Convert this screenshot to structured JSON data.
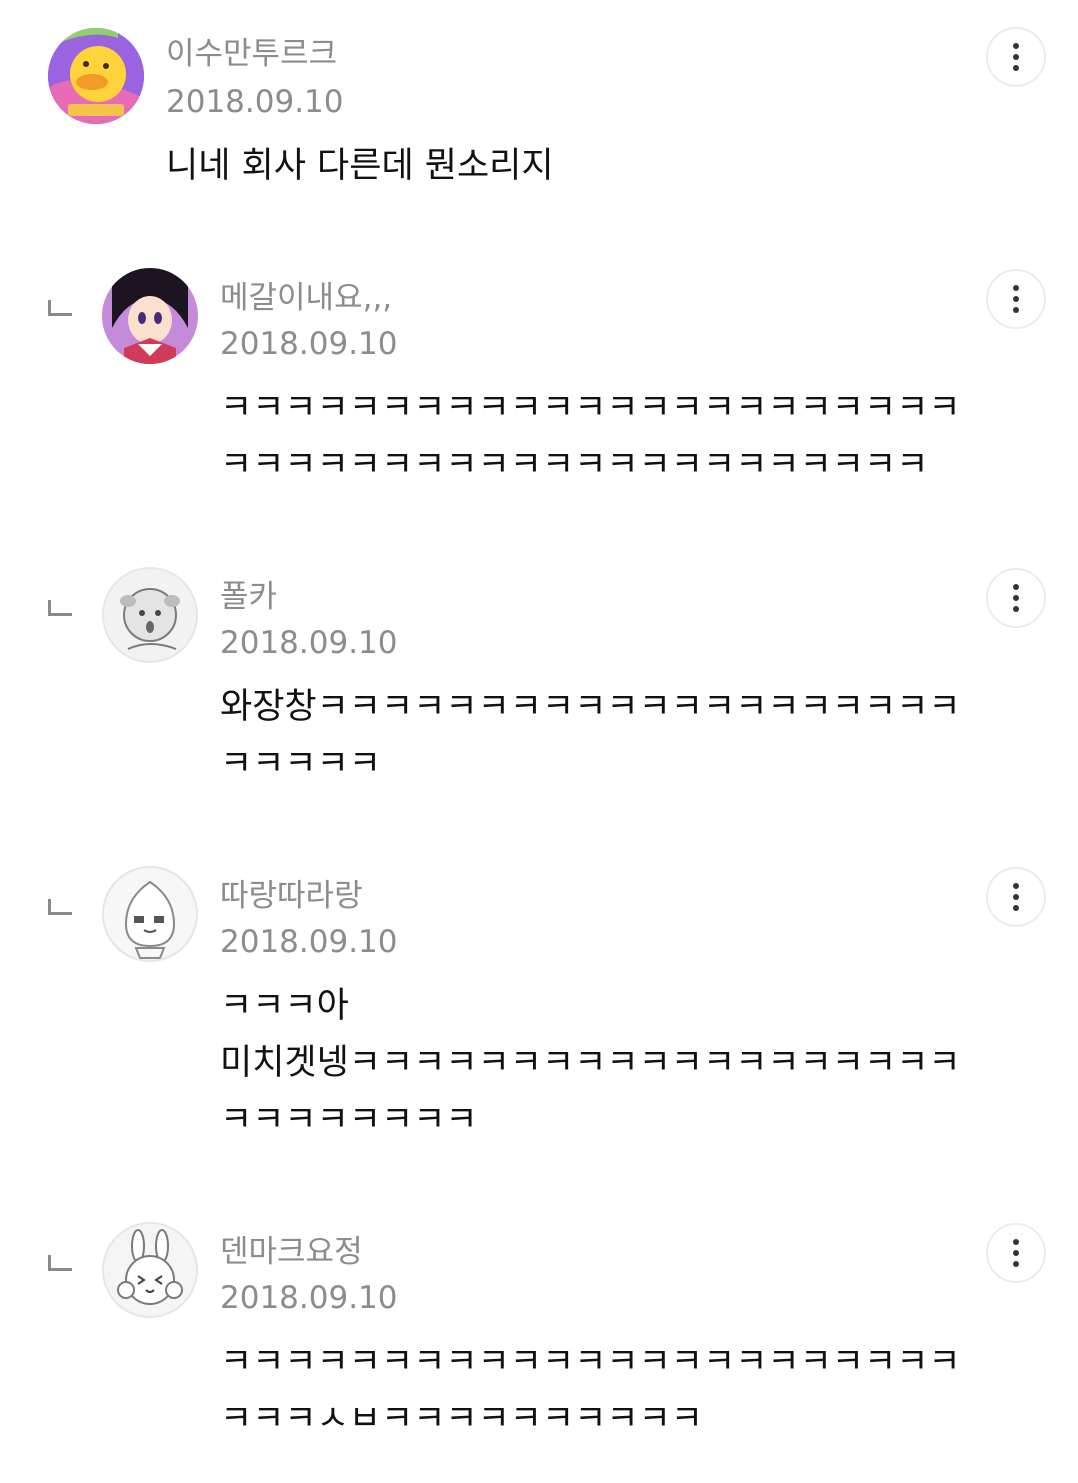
{
  "comments": [
    {
      "author": "이수만투르크",
      "date": "2018.09.10",
      "text": "니네 회사 다른데 뭔소리지",
      "avatar_icon": "duck-avatar-icon",
      "is_reply": false
    },
    {
      "author": "메갈이내요,,,",
      "date": "2018.09.10",
      "text": "ㅋㅋㅋㅋㅋㅋㅋㅋㅋㅋㅋㅋㅋㅋㅋㅋㅋㅋㅋㅋㅋㅋㅋ\nㅋㅋㅋㅋㅋㅋㅋㅋㅋㅋㅋㅋㅋㅋㅋㅋㅋㅋㅋㅋㅋㅋ",
      "avatar_icon": "anime-girl-avatar-icon",
      "is_reply": true
    },
    {
      "author": "폴카",
      "date": "2018.09.10",
      "text": "와장창ㅋㅋㅋㅋㅋㅋㅋㅋㅋㅋㅋㅋㅋㅋㅋㅋㅋㅋㅋㅋ\nㅋㅋㅋㅋㅋ",
      "avatar_icon": "dog-avatar-icon",
      "is_reply": true
    },
    {
      "author": "따랑따라랑",
      "date": "2018.09.10",
      "text": "ㅋㅋㅋ아\n미치겟넹ㅋㅋㅋㅋㅋㅋㅋㅋㅋㅋㅋㅋㅋㅋㅋㅋㅋㅋㅋ\nㅋㅋㅋㅋㅋㅋㅋㅋ",
      "avatar_icon": "peach-avatar-icon",
      "is_reply": true
    },
    {
      "author": "덴마크요정",
      "date": "2018.09.10",
      "text": "ㅋㅋㅋㅋㅋㅋㅋㅋㅋㅋㅋㅋㅋㅋㅋㅋㅋㅋㅋㅋㅋㅋㅋ\nㅋㅋㅋㅅㅂㅋㅋㅋㅋㅋㅋㅋㅋㅋㅋ",
      "avatar_icon": "rabbit-avatar-icon",
      "is_reply": true
    }
  ],
  "colors": {
    "meta_text": "#8c8c8c",
    "body_text": "#111111",
    "button_border": "#ececec",
    "reply_mark": "#8a8a8a"
  }
}
